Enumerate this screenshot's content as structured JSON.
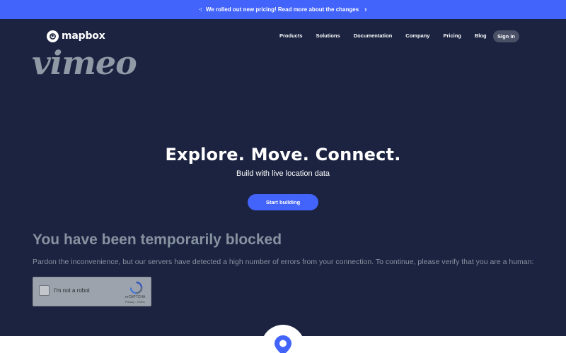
{
  "banner": {
    "text": "We rolled out new pricing! Read more about the changes",
    "sparkle": "·:",
    "chevron": "›"
  },
  "nav": {
    "logo_text": "mapbox",
    "links": [
      "Products",
      "Solutions",
      "Documentation",
      "Company",
      "Pricing",
      "Blog"
    ],
    "signin_label": "Sign in"
  },
  "vimeo": {
    "logo_text": "vimeo"
  },
  "hero": {
    "title": "Explore. Move. Connect.",
    "subtitle": "Build with live location data",
    "cta_label": "Start building"
  },
  "block": {
    "title": "You have been temporarily blocked",
    "message": "Pardon the inconvenience, but our servers have detected a high number of errors from your connection. To continue, please verify that you are a human:"
  },
  "captcha": {
    "label": "I'm not a robot",
    "brand": "reCAPTCHA",
    "privacy": "Privacy",
    "separator": " - ",
    "terms": "Terms"
  },
  "colors": {
    "background": "#1b2340",
    "accent": "#4264fb",
    "muted_text": "#8792a0",
    "signin_bg": "#4a5167"
  },
  "icons": [
    "sparkle-icon",
    "chevron-right-icon",
    "mapbox-logo-icon",
    "recaptcha-icon",
    "map-pin-icon"
  ]
}
